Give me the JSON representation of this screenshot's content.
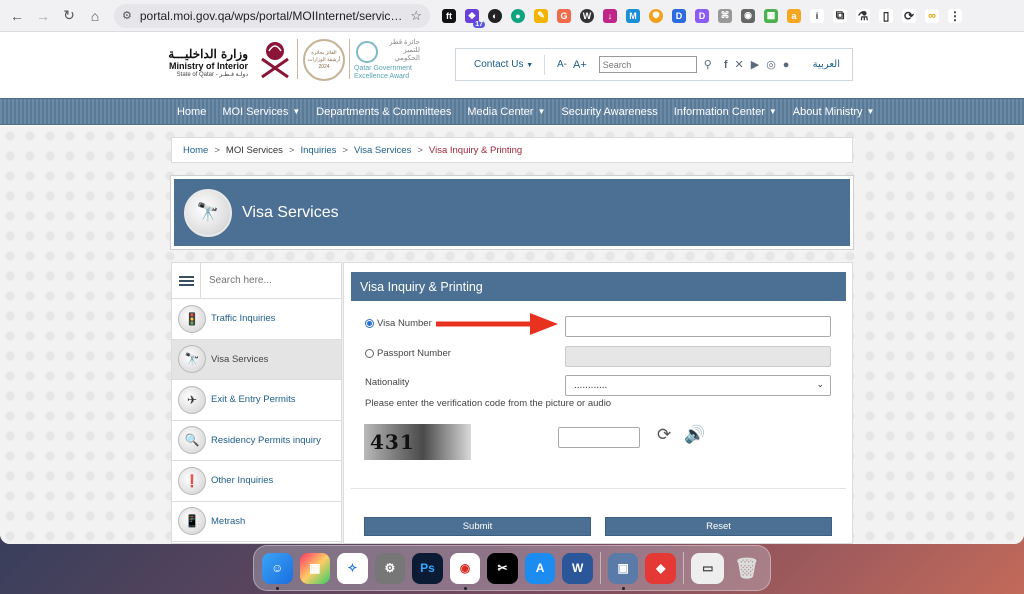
{
  "browser": {
    "url": "portal.moi.gov.qa/wps/portal/MOIInternet/services/in...",
    "extension_badge": "17"
  },
  "header": {
    "logo_arabic": "وزارة الداخليـــة",
    "logo_english": "Ministry of Interior",
    "logo_state": "State of Qatar - دولـة قـطـر",
    "award_arabic": "الفائز بجائزة أرشفة الوزارات 2024",
    "qga_arabic": "جائزة قطر للتميز الحكومي",
    "qga_english": "Qatar Government Excellence Award",
    "contact_label": "Contact Us",
    "font_decrease": "A-",
    "font_increase": "A+",
    "search_placeholder": "Search",
    "arabic_link": "العربية"
  },
  "nav": {
    "items": [
      {
        "label": "Home",
        "has_menu": false
      },
      {
        "label": "MOI Services",
        "has_menu": true
      },
      {
        "label": "Departments & Committees",
        "has_menu": false
      },
      {
        "label": "Media Center",
        "has_menu": true
      },
      {
        "label": "Security Awareness",
        "has_menu": false
      },
      {
        "label": "Information Center",
        "has_menu": true
      },
      {
        "label": "About Ministry",
        "has_menu": true
      }
    ]
  },
  "breadcrumb": {
    "home": "Home",
    "moi_services": "MOI Services",
    "inquiries": "Inquiries",
    "visa_services": "Visa Services",
    "current": "Visa Inquiry & Printing",
    "sep": ">"
  },
  "banner": {
    "title": "Visa Services"
  },
  "sidebar": {
    "search_placeholder": "Search here...",
    "items": [
      {
        "label": "Traffic Inquiries",
        "icon": "traffic-light-icon",
        "glyph": "🚦"
      },
      {
        "label": "Visa Services",
        "icon": "visa-icon",
        "glyph": "🔭"
      },
      {
        "label": "Exit & Entry Permits",
        "icon": "plane-icon",
        "glyph": "✈"
      },
      {
        "label": "Residency Permits inquiry",
        "icon": "residency-icon",
        "glyph": "🔍"
      },
      {
        "label": "Other Inquiries",
        "icon": "info-icon",
        "glyph": "❗"
      },
      {
        "label": "Metrash",
        "icon": "phone-icon",
        "glyph": "📱"
      }
    ]
  },
  "form": {
    "title": "Visa Inquiry & Printing",
    "visa_number_label": "Visa Number",
    "visa_number_value": "",
    "passport_number_label": "Passport Number",
    "passport_number_value": "",
    "nationality_label": "Nationality",
    "nationality_selected": "............",
    "verification_hint": "Please enter the verification code from the picture or audio",
    "captcha_text": "431",
    "captcha_input_value": "",
    "submit_label": "Submit",
    "reset_label": "Reset"
  },
  "colors": {
    "brand_blue": "#4b7093",
    "link_blue": "#1d5d8a",
    "breadcrumb_current": "#a0273b",
    "arrow_red": "#e8321f"
  }
}
